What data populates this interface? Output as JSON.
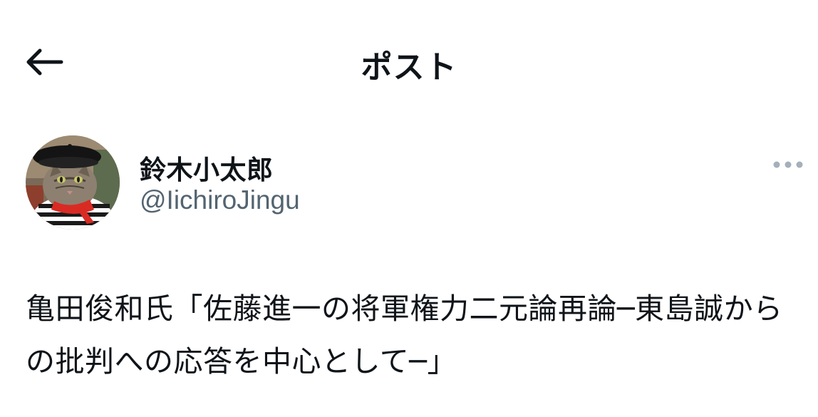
{
  "header": {
    "title": "ポスト",
    "back_icon": "arrow-left-icon"
  },
  "author": {
    "display_name": "鈴木小太郎",
    "handle": "@IichiroJingu",
    "avatar_icon": "cat-in-beret-avatar",
    "more_icon": "more-horizontal-icon"
  },
  "post": {
    "text": "亀田俊和氏「佐藤進一の将軍権力二元論再論─東島誠からの批判への応答を中心として─」"
  },
  "colors": {
    "text_primary": "#0f1419",
    "text_secondary": "#536471",
    "more_dots": "#a4b0bb",
    "background": "#ffffff"
  }
}
